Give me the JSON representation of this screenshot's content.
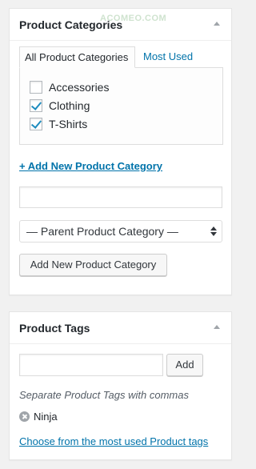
{
  "categories_box": {
    "title": "Product Categories",
    "watermark": "ACOMEO.COM",
    "tabs": [
      {
        "label": "All Product Categories",
        "active": true
      },
      {
        "label": "Most Used",
        "active": false
      }
    ],
    "items": [
      {
        "label": "Accessories",
        "checked": false
      },
      {
        "label": "Clothing",
        "checked": true
      },
      {
        "label": "T-Shirts",
        "checked": true
      }
    ],
    "add_link": "+ Add New Product Category",
    "new_category_value": "",
    "parent_select": "— Parent Product Category —",
    "add_button": "Add New Product Category"
  },
  "tags_box": {
    "title": "Product Tags",
    "input_value": "",
    "add_button": "Add",
    "hint": "Separate Product Tags with commas",
    "tags": [
      "Ninja"
    ],
    "choose_link": "Choose from the most used Product tags"
  },
  "colors": {
    "link": "#0073aa",
    "background": "#f1f1f1",
    "check": "#1e8cbe"
  }
}
